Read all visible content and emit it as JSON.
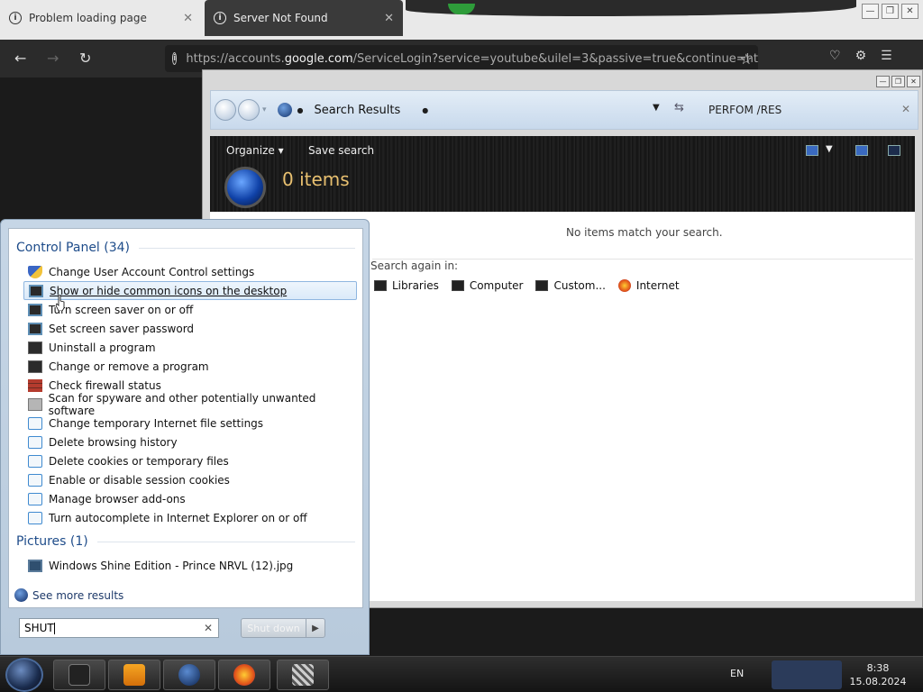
{
  "browser": {
    "tabs": [
      {
        "label": "Problem loading page",
        "active": false
      },
      {
        "label": "Server Not Found",
        "active": true
      }
    ],
    "url_prefix": "https://accounts.",
    "url_host": "google.com",
    "url_rest": "/ServiceLogin?service=youtube&uilel=3&passive=true&continue=ht"
  },
  "explorer": {
    "address": "Search Results",
    "search_box": "PERFOM /RES",
    "toolbar": {
      "organize": "Organize",
      "save_search": "Save search"
    },
    "items_count": "0 items",
    "no_items": "No items match your search.",
    "search_again": "Search again in:",
    "locations": [
      "Libraries",
      "Computer",
      "Custom...",
      "Internet"
    ]
  },
  "start_menu": {
    "control_panel_header": "Control Panel (34)",
    "control_panel_items": [
      "Change User Account Control settings",
      "Show or hide common icons on the desktop",
      "Turn screen saver on or off",
      "Set screen saver password",
      "Uninstall a program",
      "Change or remove a program",
      "Check firewall status",
      "Scan for spyware and other potentially unwanted software",
      "Change temporary Internet file settings",
      "Delete browsing history",
      "Delete cookies or temporary files",
      "Enable or disable session cookies",
      "Manage browser add-ons",
      "Turn autocomplete in Internet Explorer on or off"
    ],
    "pictures_header": "Pictures (1)",
    "pictures_items": [
      "Windows Shine Edition - Prince NRVL (12).jpg"
    ],
    "see_more": "See more results",
    "search_value": "SHUT",
    "shutdown_label": "Shut down"
  },
  "taskbar": {
    "language": "EN",
    "time": "8:38",
    "date": "15.08.2024"
  },
  "colors": {
    "accent_blue": "#1e4c8a",
    "items_gold": "#e8c070",
    "selection_border": "#8fb6e0"
  }
}
